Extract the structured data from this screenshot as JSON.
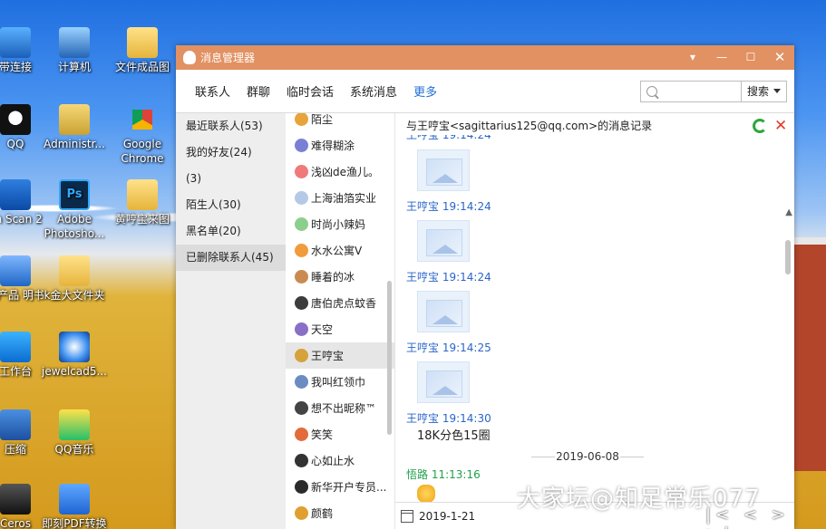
{
  "desktop": {
    "icons": [
      {
        "label": "带连接",
        "icon": "network-icon"
      },
      {
        "label": "计算机",
        "icon": "computer-icon"
      },
      {
        "label": "文件成品图",
        "icon": "folder-icon"
      },
      {
        "label": "QQ",
        "icon": "qq-icon"
      },
      {
        "label": "Administr...",
        "icon": "user-folder-icon"
      },
      {
        "label": "Google Chrome",
        "icon": "chrome-icon"
      },
      {
        "label": "on Scan 2",
        "icon": "scan-icon"
      },
      {
        "label": "Adobe Photosho...",
        "icon": "photoshop-icon"
      },
      {
        "label": "黄哼宝来图",
        "icon": "folder-icon"
      },
      {
        "label": "生产品 明书",
        "icon": "doc-icon"
      },
      {
        "label": "k金大文件夹",
        "icon": "folder-icon"
      },
      {
        "label": "工作台",
        "icon": "app-icon"
      },
      {
        "label": "jewelcad5...",
        "icon": "jewelcad-icon"
      },
      {
        "label": "压缩",
        "icon": "zip-icon"
      },
      {
        "label": "QQ音乐",
        "icon": "qq-music-icon"
      },
      {
        "label": "Ceros",
        "icon": "corel-icon"
      },
      {
        "label": "即刻PDF转换",
        "icon": "pdf-icon"
      }
    ]
  },
  "window": {
    "title": "消息管理器",
    "tabs": [
      {
        "label": "联系人",
        "active": false
      },
      {
        "label": "群聊",
        "active": false
      },
      {
        "label": "临时会话",
        "active": false
      },
      {
        "label": "系统消息",
        "active": false
      },
      {
        "label": "更多",
        "active": true
      }
    ],
    "search": {
      "placeholder": "",
      "button_label": "搜索"
    },
    "categories": [
      {
        "label": "最近联系人(53)",
        "selected": false
      },
      {
        "label": "我的好友(24)",
        "selected": false
      },
      {
        "label": "(3)",
        "selected": false
      },
      {
        "label": "陌生人(30)",
        "selected": false
      },
      {
        "label": "黑名单(20)",
        "selected": false
      },
      {
        "label": "已删除联系人(45)",
        "selected": true
      }
    ],
    "contacts": [
      {
        "name": "陌尘",
        "color": "#e8a33a"
      },
      {
        "name": "难得糊涂",
        "color": "#7a7fd6"
      },
      {
        "name": "浅凶de渔儿。",
        "color": "#f07a7a"
      },
      {
        "name": "上海油箔实业",
        "color": "#b5c9e6"
      },
      {
        "name": "时尚小辣妈",
        "color": "#8ccf8c"
      },
      {
        "name": "水水公寓V",
        "color": "#f29b3c"
      },
      {
        "name": "睡着的冰",
        "color": "#c98b52"
      },
      {
        "name": "唐伯虎点蚊香",
        "color": "#3c3c3c"
      },
      {
        "name": "天空",
        "color": "#8a6fc7"
      },
      {
        "name": "王哼宝",
        "color": "#d6a23a",
        "selected": true
      },
      {
        "name": "我叫红领巾",
        "color": "#6b8cc2"
      },
      {
        "name": "想不出昵称™",
        "color": "#444"
      },
      {
        "name": "笑笑",
        "color": "#e36b3a"
      },
      {
        "name": "心如止水",
        "color": "#333"
      },
      {
        "name": "新华开户专员...",
        "color": "#2b2b2b"
      },
      {
        "name": "颜鹤",
        "color": "#e0a030"
      }
    ],
    "record_header": "与王哼宝<sagittarius125@qq.com>的消息记录",
    "messages": [
      {
        "sender": "王哼宝 19:14:24"
      },
      {
        "sender": "王哼宝 19:14:24"
      },
      {
        "sender": "王哼宝 19:14:24"
      },
      {
        "sender": "王哼宝 19:14:25"
      },
      {
        "sender": "王哼宝 19:14:30",
        "text": "18K分色15圈"
      }
    ],
    "date_separator": "2019-06-08",
    "second_sender": "悟路 11:13:16",
    "bottom_date": "2019-1-21"
  },
  "watermark": "大家坛@知足常乐077",
  "pager": "|< < > >|"
}
